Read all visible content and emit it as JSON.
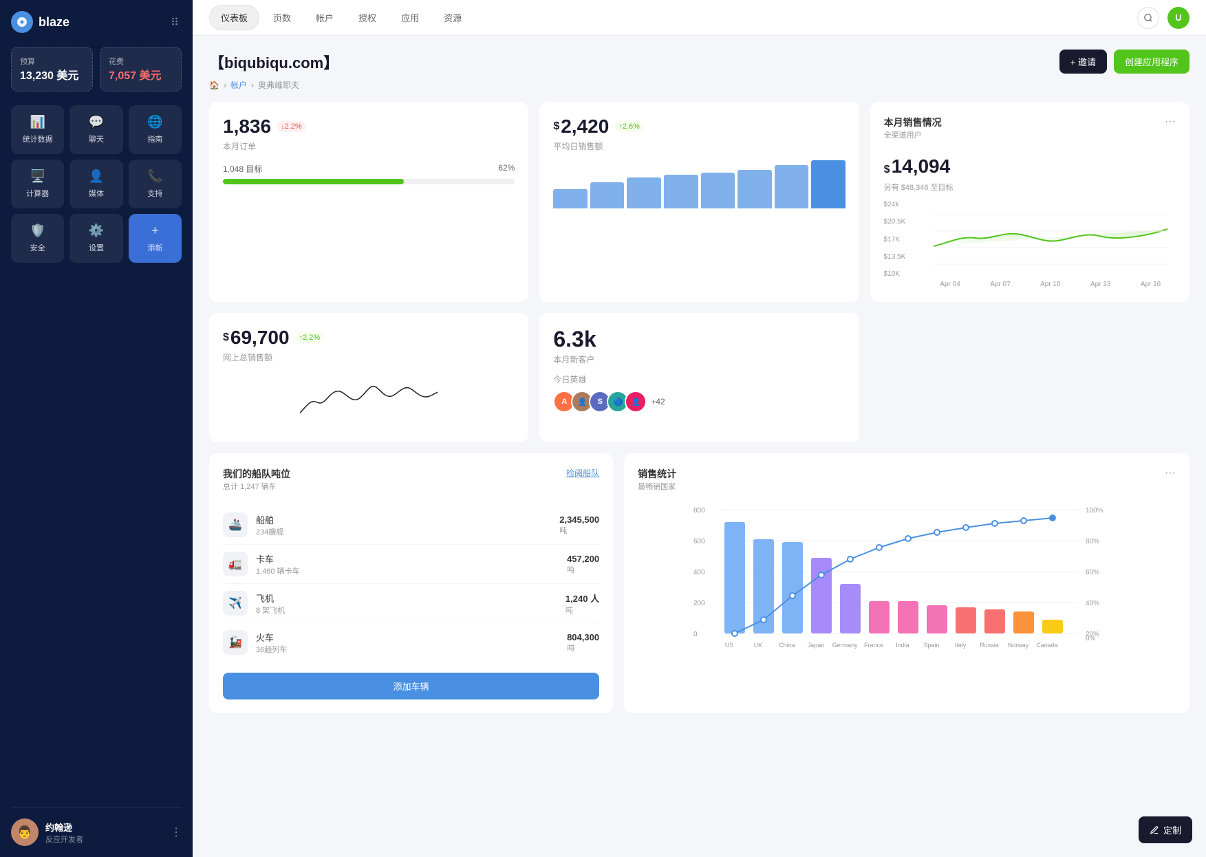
{
  "sidebar": {
    "logo_text": "blaze",
    "budget": {
      "label": "预算",
      "value": "13,230 美元"
    },
    "expense": {
      "label": "花费",
      "value": "7,057 美元"
    },
    "nav_items": [
      {
        "id": "analytics",
        "label": "统计数据",
        "icon": "📊"
      },
      {
        "id": "chat",
        "label": "聊天",
        "icon": "💬"
      },
      {
        "id": "guide",
        "label": "指南",
        "icon": "🌐"
      },
      {
        "id": "calculator",
        "label": "计算器",
        "icon": "🖥️"
      },
      {
        "id": "media",
        "label": "媒体",
        "icon": "👤"
      },
      {
        "id": "support",
        "label": "支持",
        "icon": "📞"
      },
      {
        "id": "security",
        "label": "安全",
        "icon": "🛡️"
      },
      {
        "id": "settings",
        "label": "设置",
        "icon": "⚙️"
      },
      {
        "id": "add",
        "label": "添新",
        "icon": "+"
      }
    ],
    "user": {
      "name": "约翰逊",
      "role": "反应开发者"
    }
  },
  "top_nav": {
    "tabs": [
      "仪表板",
      "页数",
      "帐户",
      "授权",
      "应用",
      "资源"
    ],
    "active_tab": "仪表板"
  },
  "page": {
    "title": "【biqubiqu.com】",
    "breadcrumb": [
      "🏠",
      "帐户",
      "奥弗维耶夫"
    ],
    "invite_btn": "+ 邀请",
    "create_btn": "创建应用程序"
  },
  "stats": {
    "orders": {
      "value": "1,836",
      "label": "本月订单",
      "badge": "↓2.2%",
      "badge_type": "down",
      "target_label": "1,048 目标",
      "progress": 62,
      "progress_pct": "62%"
    },
    "avg_sales": {
      "prefix": "$",
      "value": "2,420",
      "label": "平均日销售额",
      "badge": "↑2.6%",
      "badge_type": "up",
      "bars": [
        40,
        55,
        65,
        70,
        75,
        80,
        90,
        100
      ]
    },
    "monthly_sales": {
      "title": "本月销售情况",
      "subtitle": "全渠道用户",
      "prefix": "$",
      "value": "14,094",
      "note": "另有 $48,346 至目标",
      "y_labels": [
        "$24k",
        "$20.5K",
        "$17K",
        "$13.5K",
        "$10K"
      ],
      "x_labels": [
        "Apr 04",
        "Apr 07",
        "Apr 10",
        "Apr 13",
        "Apr 16"
      ]
    },
    "total_sales": {
      "prefix": "$",
      "value": "69,700",
      "label": "网上总销售额",
      "badge": "↑2.2%",
      "badge_type": "up"
    },
    "new_customers": {
      "value": "6.3k",
      "label": "本月新客户",
      "heroes_label": "今日英雄",
      "extra_count": "+42"
    }
  },
  "fleet": {
    "title": "我们的船队吨位",
    "subtitle": "总计 1,247 辆车",
    "link": "检阅船队",
    "items": [
      {
        "icon": "🚢",
        "name": "船舶",
        "count": "234艘舰",
        "value": "2,345,500",
        "unit": "吨"
      },
      {
        "icon": "🚛",
        "name": "卡车",
        "count": "1,460 辆卡车",
        "value": "457,200",
        "unit": "吨"
      },
      {
        "icon": "✈️",
        "name": "飞机",
        "count": "8 架飞机",
        "value": "1,240 人",
        "unit": "吨"
      },
      {
        "icon": "🚂",
        "name": "火车",
        "count": "36趟列车",
        "value": "804,300",
        "unit": "吨"
      }
    ],
    "add_btn": "添加车辆"
  },
  "sales_chart": {
    "title": "销售统计",
    "subtitle": "最畅销国家",
    "countries": [
      "US",
      "UK",
      "China",
      "Japan",
      "Germany",
      "France",
      "India",
      "Spain",
      "Italy",
      "Russia",
      "Norway",
      "Canada"
    ],
    "values": [
      720,
      620,
      600,
      500,
      320,
      210,
      210,
      180,
      170,
      150,
      140,
      80
    ],
    "colors": [
      "#7eb3f5",
      "#7eb3f5",
      "#7eb3f5",
      "#a78bfa",
      "#a78bfa",
      "#f472b6",
      "#f472b6",
      "#f472b6",
      "#f87171",
      "#f87171",
      "#fb923c",
      "#facc15"
    ],
    "y_max": 800,
    "pct_labels": [
      "100%",
      "80%",
      "60%",
      "40%",
      "20%",
      "0%"
    ]
  },
  "customize_btn": "定制"
}
